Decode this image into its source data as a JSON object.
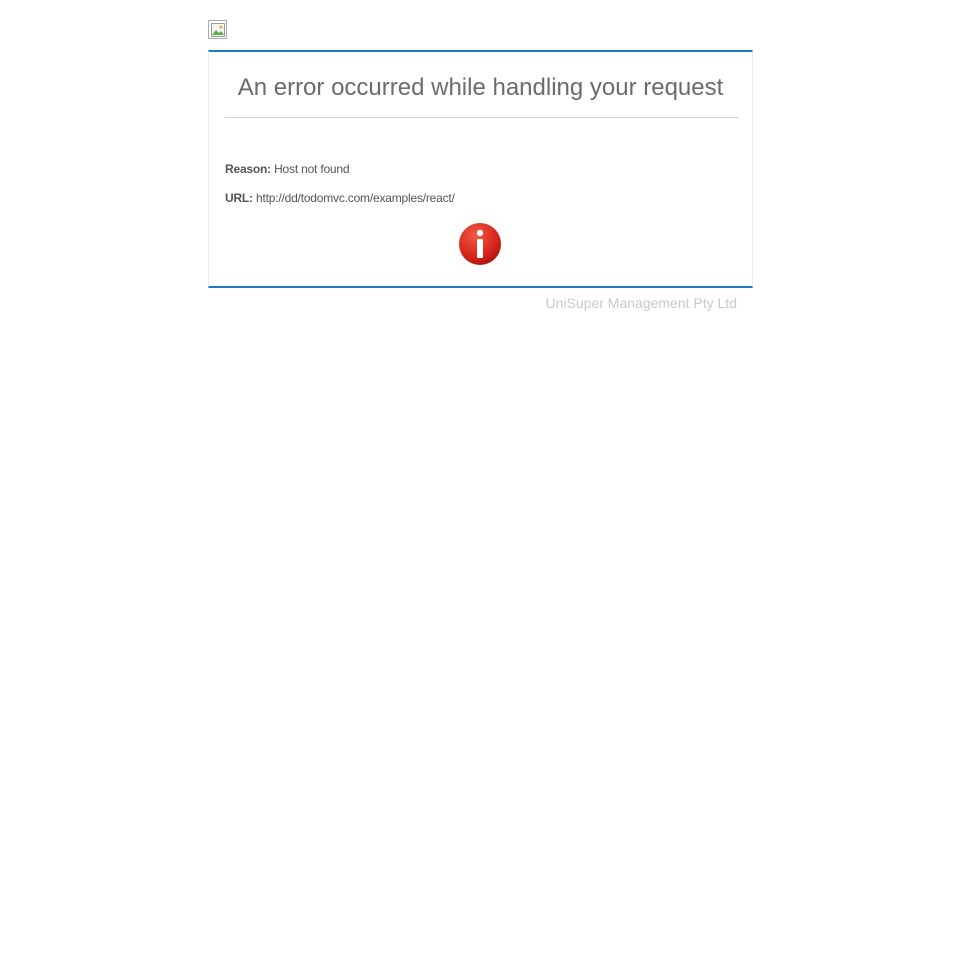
{
  "page": {
    "title": "An error occurred while handling your request",
    "reason_label": "Reason:",
    "reason_value": "Host not found",
    "url_label": "URL:",
    "url_value": "http://dd/todomvc.com/examples/react/",
    "footer": "UniSuper Management Pty Ltd"
  },
  "icons": {
    "logo": "broken-image-icon",
    "status": "info-icon"
  },
  "colors": {
    "accent": "#1a7dc4",
    "icon_red": "#d9261c",
    "title_text": "#6b6b6b",
    "footer_text": "#c9c9c9"
  }
}
